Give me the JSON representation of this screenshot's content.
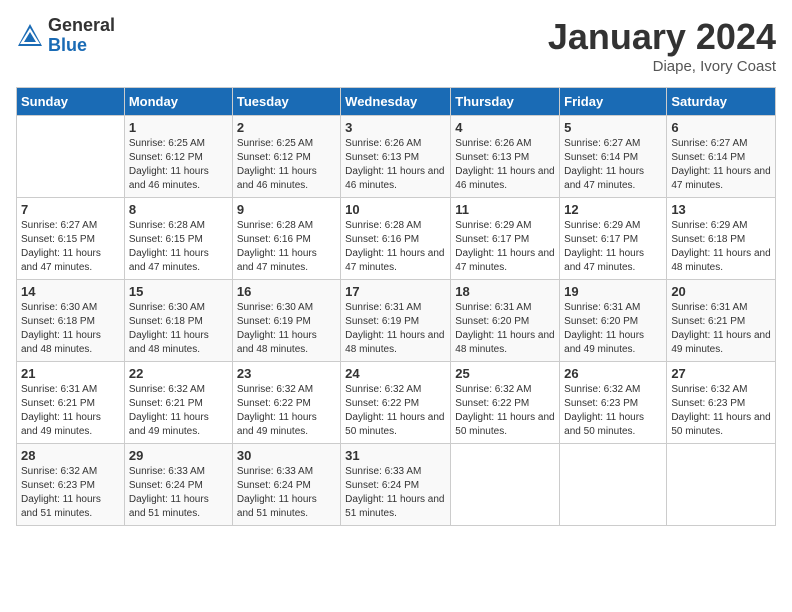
{
  "logo": {
    "general": "General",
    "blue": "Blue"
  },
  "title": "January 2024",
  "subtitle": "Diape, Ivory Coast",
  "days_of_week": [
    "Sunday",
    "Monday",
    "Tuesday",
    "Wednesday",
    "Thursday",
    "Friday",
    "Saturday"
  ],
  "weeks": [
    [
      {
        "day": "",
        "sunrise": "",
        "sunset": "",
        "daylight": ""
      },
      {
        "day": "1",
        "sunrise": "Sunrise: 6:25 AM",
        "sunset": "Sunset: 6:12 PM",
        "daylight": "Daylight: 11 hours and 46 minutes."
      },
      {
        "day": "2",
        "sunrise": "Sunrise: 6:25 AM",
        "sunset": "Sunset: 6:12 PM",
        "daylight": "Daylight: 11 hours and 46 minutes."
      },
      {
        "day": "3",
        "sunrise": "Sunrise: 6:26 AM",
        "sunset": "Sunset: 6:13 PM",
        "daylight": "Daylight: 11 hours and 46 minutes."
      },
      {
        "day": "4",
        "sunrise": "Sunrise: 6:26 AM",
        "sunset": "Sunset: 6:13 PM",
        "daylight": "Daylight: 11 hours and 46 minutes."
      },
      {
        "day": "5",
        "sunrise": "Sunrise: 6:27 AM",
        "sunset": "Sunset: 6:14 PM",
        "daylight": "Daylight: 11 hours and 47 minutes."
      },
      {
        "day": "6",
        "sunrise": "Sunrise: 6:27 AM",
        "sunset": "Sunset: 6:14 PM",
        "daylight": "Daylight: 11 hours and 47 minutes."
      }
    ],
    [
      {
        "day": "7",
        "sunrise": "Sunrise: 6:27 AM",
        "sunset": "Sunset: 6:15 PM",
        "daylight": "Daylight: 11 hours and 47 minutes."
      },
      {
        "day": "8",
        "sunrise": "Sunrise: 6:28 AM",
        "sunset": "Sunset: 6:15 PM",
        "daylight": "Daylight: 11 hours and 47 minutes."
      },
      {
        "day": "9",
        "sunrise": "Sunrise: 6:28 AM",
        "sunset": "Sunset: 6:16 PM",
        "daylight": "Daylight: 11 hours and 47 minutes."
      },
      {
        "day": "10",
        "sunrise": "Sunrise: 6:28 AM",
        "sunset": "Sunset: 6:16 PM",
        "daylight": "Daylight: 11 hours and 47 minutes."
      },
      {
        "day": "11",
        "sunrise": "Sunrise: 6:29 AM",
        "sunset": "Sunset: 6:17 PM",
        "daylight": "Daylight: 11 hours and 47 minutes."
      },
      {
        "day": "12",
        "sunrise": "Sunrise: 6:29 AM",
        "sunset": "Sunset: 6:17 PM",
        "daylight": "Daylight: 11 hours and 47 minutes."
      },
      {
        "day": "13",
        "sunrise": "Sunrise: 6:29 AM",
        "sunset": "Sunset: 6:18 PM",
        "daylight": "Daylight: 11 hours and 48 minutes."
      }
    ],
    [
      {
        "day": "14",
        "sunrise": "Sunrise: 6:30 AM",
        "sunset": "Sunset: 6:18 PM",
        "daylight": "Daylight: 11 hours and 48 minutes."
      },
      {
        "day": "15",
        "sunrise": "Sunrise: 6:30 AM",
        "sunset": "Sunset: 6:18 PM",
        "daylight": "Daylight: 11 hours and 48 minutes."
      },
      {
        "day": "16",
        "sunrise": "Sunrise: 6:30 AM",
        "sunset": "Sunset: 6:19 PM",
        "daylight": "Daylight: 11 hours and 48 minutes."
      },
      {
        "day": "17",
        "sunrise": "Sunrise: 6:31 AM",
        "sunset": "Sunset: 6:19 PM",
        "daylight": "Daylight: 11 hours and 48 minutes."
      },
      {
        "day": "18",
        "sunrise": "Sunrise: 6:31 AM",
        "sunset": "Sunset: 6:20 PM",
        "daylight": "Daylight: 11 hours and 48 minutes."
      },
      {
        "day": "19",
        "sunrise": "Sunrise: 6:31 AM",
        "sunset": "Sunset: 6:20 PM",
        "daylight": "Daylight: 11 hours and 49 minutes."
      },
      {
        "day": "20",
        "sunrise": "Sunrise: 6:31 AM",
        "sunset": "Sunset: 6:21 PM",
        "daylight": "Daylight: 11 hours and 49 minutes."
      }
    ],
    [
      {
        "day": "21",
        "sunrise": "Sunrise: 6:31 AM",
        "sunset": "Sunset: 6:21 PM",
        "daylight": "Daylight: 11 hours and 49 minutes."
      },
      {
        "day": "22",
        "sunrise": "Sunrise: 6:32 AM",
        "sunset": "Sunset: 6:21 PM",
        "daylight": "Daylight: 11 hours and 49 minutes."
      },
      {
        "day": "23",
        "sunrise": "Sunrise: 6:32 AM",
        "sunset": "Sunset: 6:22 PM",
        "daylight": "Daylight: 11 hours and 49 minutes."
      },
      {
        "day": "24",
        "sunrise": "Sunrise: 6:32 AM",
        "sunset": "Sunset: 6:22 PM",
        "daylight": "Daylight: 11 hours and 50 minutes."
      },
      {
        "day": "25",
        "sunrise": "Sunrise: 6:32 AM",
        "sunset": "Sunset: 6:22 PM",
        "daylight": "Daylight: 11 hours and 50 minutes."
      },
      {
        "day": "26",
        "sunrise": "Sunrise: 6:32 AM",
        "sunset": "Sunset: 6:23 PM",
        "daylight": "Daylight: 11 hours and 50 minutes."
      },
      {
        "day": "27",
        "sunrise": "Sunrise: 6:32 AM",
        "sunset": "Sunset: 6:23 PM",
        "daylight": "Daylight: 11 hours and 50 minutes."
      }
    ],
    [
      {
        "day": "28",
        "sunrise": "Sunrise: 6:32 AM",
        "sunset": "Sunset: 6:23 PM",
        "daylight": "Daylight: 11 hours and 51 minutes."
      },
      {
        "day": "29",
        "sunrise": "Sunrise: 6:33 AM",
        "sunset": "Sunset: 6:24 PM",
        "daylight": "Daylight: 11 hours and 51 minutes."
      },
      {
        "day": "30",
        "sunrise": "Sunrise: 6:33 AM",
        "sunset": "Sunset: 6:24 PM",
        "daylight": "Daylight: 11 hours and 51 minutes."
      },
      {
        "day": "31",
        "sunrise": "Sunrise: 6:33 AM",
        "sunset": "Sunset: 6:24 PM",
        "daylight": "Daylight: 11 hours and 51 minutes."
      },
      {
        "day": "",
        "sunrise": "",
        "sunset": "",
        "daylight": ""
      },
      {
        "day": "",
        "sunrise": "",
        "sunset": "",
        "daylight": ""
      },
      {
        "day": "",
        "sunrise": "",
        "sunset": "",
        "daylight": ""
      }
    ]
  ]
}
